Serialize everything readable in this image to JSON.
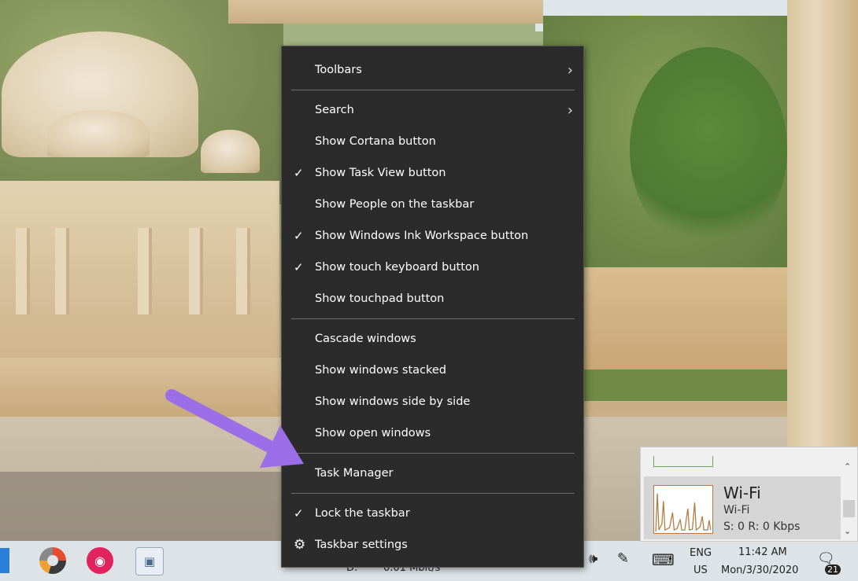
{
  "context_menu": {
    "items": [
      {
        "label": "Toolbars",
        "checked": false,
        "submenu": true
      },
      {
        "label": "Search",
        "checked": false,
        "submenu": true
      },
      {
        "label": "Show Cortana button",
        "checked": false,
        "submenu": false
      },
      {
        "label": "Show Task View button",
        "checked": true,
        "submenu": false
      },
      {
        "label": "Show People on the taskbar",
        "checked": false,
        "submenu": false
      },
      {
        "label": "Show Windows Ink Workspace button",
        "checked": true,
        "submenu": false
      },
      {
        "label": "Show touch keyboard button",
        "checked": true,
        "submenu": false
      },
      {
        "label": "Show touchpad button",
        "checked": false,
        "submenu": false
      },
      {
        "label": "Cascade windows",
        "checked": false,
        "submenu": false
      },
      {
        "label": "Show windows stacked",
        "checked": false,
        "submenu": false
      },
      {
        "label": "Show windows side by side",
        "checked": false,
        "submenu": false
      },
      {
        "label": "Show open windows",
        "checked": false,
        "submenu": false
      },
      {
        "label": "Task Manager",
        "checked": false,
        "submenu": false
      },
      {
        "label": "Lock the taskbar",
        "checked": true,
        "submenu": false
      },
      {
        "label": "Taskbar settings",
        "checked": false,
        "submenu": false,
        "icon": "gear-icon"
      }
    ],
    "check_glyph": "✓",
    "chevron_glyph": "›",
    "gear_glyph": "⚙"
  },
  "network_flyout": {
    "title": "Wi-Fi",
    "subtitle": "Wi-Fi",
    "rate": "S: 0 R: 0 Kbps"
  },
  "taskbar": {
    "partial_drive": "D:",
    "partial_speed": "0.01 Mbit/s",
    "language_top": "ENG",
    "language_bottom": "US",
    "time": "11:42 AM",
    "date": "Mon/3/30/2020",
    "notification_count": "21"
  },
  "colors": {
    "menu_bg": "#2b2b2b",
    "menu_text": "#ffffff",
    "arrow": "#9b6de6",
    "taskbar_bg": "#dde3e6"
  }
}
